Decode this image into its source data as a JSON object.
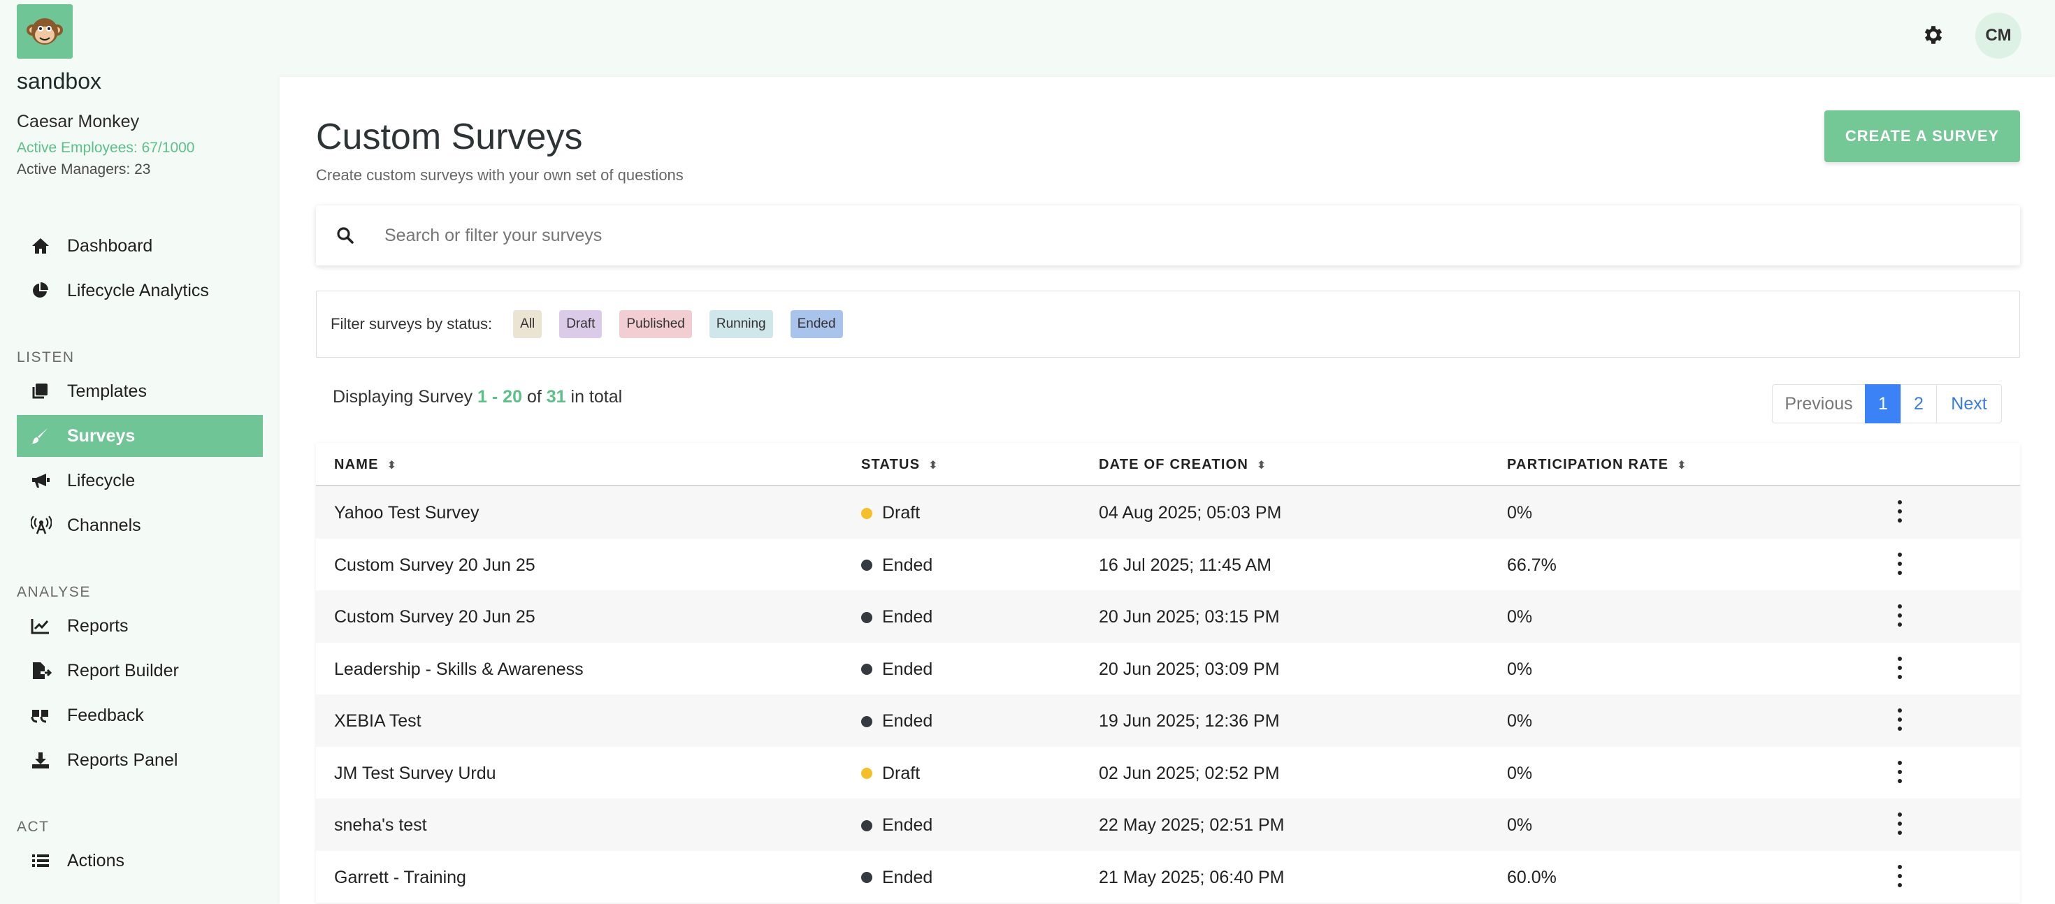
{
  "org": {
    "name": "sandbox"
  },
  "user": {
    "name": "Caesar Monkey",
    "active_employees": "Active Employees: 67/1000",
    "active_managers": "Active Managers: 23",
    "initials": "CM"
  },
  "sidebar": {
    "top_items": [
      {
        "label": "Dashboard",
        "icon": "home-icon"
      },
      {
        "label": "Lifecycle Analytics",
        "icon": "pie-chart-icon"
      }
    ],
    "sections": [
      {
        "label": "LISTEN",
        "items": [
          {
            "label": "Templates",
            "icon": "copy-icon"
          },
          {
            "label": "Surveys",
            "icon": "brush-icon",
            "active": true
          },
          {
            "label": "Lifecycle",
            "icon": "bullhorn-icon"
          },
          {
            "label": "Channels",
            "icon": "broadcast-tower-icon"
          }
        ]
      },
      {
        "label": "ANALYSE",
        "items": [
          {
            "label": "Reports",
            "icon": "line-chart-icon"
          },
          {
            "label": "Report Builder",
            "icon": "file-export-icon"
          },
          {
            "label": "Feedback",
            "icon": "quote-icon"
          },
          {
            "label": "Reports Panel",
            "icon": "download-icon"
          }
        ]
      },
      {
        "label": "ACT",
        "items": [
          {
            "label": "Actions",
            "icon": "list-icon"
          }
        ]
      }
    ]
  },
  "main": {
    "title": "Custom Surveys",
    "subtitle": "Create custom surveys with your own set of questions",
    "create_button": "CREATE A SURVEY",
    "search_placeholder": "Search or filter your surveys",
    "filter": {
      "label": "Filter surveys by status:",
      "chips": [
        {
          "label": "All",
          "color": "#ece4d2"
        },
        {
          "label": "Draft",
          "color": "#dccbe8"
        },
        {
          "label": "Published",
          "color": "#f2cdd1"
        },
        {
          "label": "Running",
          "color": "#cfe6ea"
        },
        {
          "label": "Ended",
          "color": "#a9c4ec"
        }
      ]
    },
    "displaying": {
      "prefix": "Displaying Survey",
      "range": "1 - 20",
      "of": "of",
      "total": "31",
      "suffix": "in total"
    },
    "pagination": {
      "previous": "Previous",
      "page1": "1",
      "page2": "2",
      "next": "Next"
    },
    "table": {
      "headers": [
        "NAME",
        "STATUS",
        "DATE OF CREATION",
        "PARTICIPATION RATE"
      ],
      "status_colors": {
        "Draft": "#f4bf2a",
        "Ended": "#343a40"
      },
      "rows": [
        {
          "name": "Yahoo Test Survey",
          "status": "Draft",
          "date": "04 Aug 2025; 05:03 PM",
          "rate": "0%"
        },
        {
          "name": "Custom Survey 20 Jun 25",
          "status": "Ended",
          "date": "16 Jul 2025; 11:45 AM",
          "rate": "66.7%"
        },
        {
          "name": "Custom Survey 20 Jun 25",
          "status": "Ended",
          "date": "20 Jun 2025; 03:15 PM",
          "rate": "0%"
        },
        {
          "name": "Leadership - Skills & Awareness",
          "status": "Ended",
          "date": "20 Jun 2025; 03:09 PM",
          "rate": "0%"
        },
        {
          "name": "XEBIA Test",
          "status": "Ended",
          "date": "19 Jun 2025; 12:36 PM",
          "rate": "0%"
        },
        {
          "name": "JM Test Survey Urdu",
          "status": "Draft",
          "date": "02 Jun 2025; 02:52 PM",
          "rate": "0%"
        },
        {
          "name": "sneha's test",
          "status": "Ended",
          "date": "22 May 2025; 02:51 PM",
          "rate": "0%"
        },
        {
          "name": "Garrett - Training",
          "status": "Ended",
          "date": "21 May 2025; 06:40 PM",
          "rate": "60.0%"
        }
      ]
    }
  }
}
